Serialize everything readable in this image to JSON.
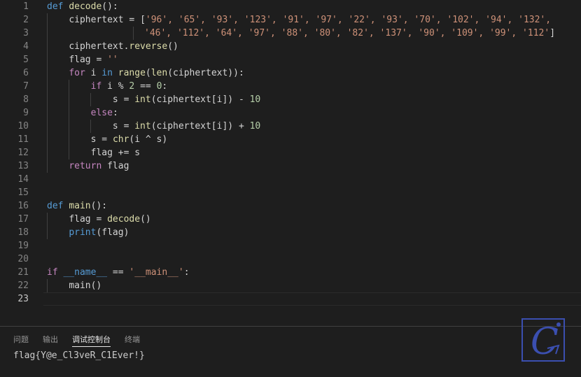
{
  "editor": {
    "line_numbers": [
      "1",
      "2",
      "3",
      "4",
      "5",
      "6",
      "7",
      "8",
      "9",
      "10",
      "11",
      "12",
      "13",
      "14",
      "15",
      "16",
      "17",
      "18",
      "19",
      "20",
      "21",
      "22",
      "23"
    ],
    "active_line": "23",
    "code": {
      "l1": {
        "kw": "def",
        "fn": "decode",
        "rest": "():"
      },
      "l2": {
        "name": "ciphertext",
        "eq": " = [",
        "items": "'96', '65', '93', '123', '91', '97', '22', '93', '70', '102', '94', '132',"
      },
      "l3": {
        "items": "'46', '112', '64', '97', '88', '80', '82', '137', '90', '109', '99', '112'",
        "close": "]"
      },
      "l4": {
        "text": "ciphertext.",
        "fn": "reverse",
        "rest": "()"
      },
      "l5": {
        "text": "flag = ",
        "str": "''"
      },
      "l6": {
        "kw": "for",
        "a": " i ",
        "kw_in": "in",
        "fn1": "range",
        "p1": "(",
        "fn2": "len",
        "rest": "(ciphertext)):"
      },
      "l7": {
        "kw": "if",
        "a": " i % ",
        "n1": "2",
        "b": " == ",
        "n2": "0",
        "c": ":"
      },
      "l8": {
        "a": "s = ",
        "fn": "int",
        "b": "(ciphertext[i]) - ",
        "n": "10"
      },
      "l9": {
        "kw": "else",
        "c": ":"
      },
      "l10": {
        "a": "s = ",
        "fn": "int",
        "b": "(ciphertext[i]) + ",
        "n": "10"
      },
      "l11": {
        "a": "s = ",
        "fn": "chr",
        "b": "(i ^ s)"
      },
      "l12": {
        "text": "flag += s"
      },
      "l13": {
        "kw": "return",
        "rest": " flag"
      },
      "l16": {
        "kw": "def",
        "fn": "main",
        "rest": "():"
      },
      "l17": {
        "a": "flag = ",
        "fn": "decode",
        "rest": "()"
      },
      "l18": {
        "fn": "print",
        "rest": "(flag)"
      },
      "l21": {
        "kw": "if",
        "a": " ",
        "name": "__name__",
        "b": " == ",
        "str": "'__main__'",
        "c": ":"
      },
      "l22": {
        "fn": "main",
        "rest": "()"
      }
    }
  },
  "panel": {
    "tabs": [
      "问题",
      "输出",
      "调试控制台",
      "终端"
    ],
    "active_tab": "调试控制台",
    "output": "flag{Y@e_Cl3veR_C1Ever!}"
  },
  "logo": {
    "letter": "C"
  },
  "colors": {
    "background": "#1e1e1e",
    "keyword": "#569cd6",
    "control": "#c586c0",
    "function": "#dcdcaa",
    "string": "#ce9178",
    "number": "#b5cea8",
    "text": "#d4d4d4",
    "logo": "#3b4fb0"
  }
}
